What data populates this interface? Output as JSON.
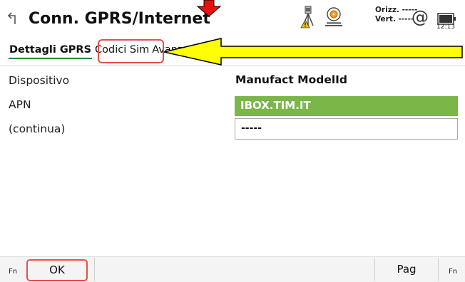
{
  "header": {
    "title": "Conn. GPRS/Internet",
    "precision": {
      "horiz_label": "Orizz.",
      "horiz_value": "-----",
      "vert_label": "Vert.",
      "vert_value": "-----"
    },
    "at_symbol": "@",
    "time": "12:13",
    "icons": [
      "back-icon",
      "total-station-warning-icon",
      "gnss-receiver-icon",
      "internet-at-icon",
      "battery-icon"
    ]
  },
  "tabs": [
    {
      "label": "Dettagli GPRS",
      "active": true
    },
    {
      "label": "Codici Sim",
      "active": false
    },
    {
      "label": "Avanzate",
      "active": false
    }
  ],
  "form": {
    "device_label": "Dispositivo",
    "device_value": "Manufact ModelId",
    "apn_label": "APN",
    "apn_value": "IBOX.TIM.IT",
    "continue_label": "(continua)",
    "continue_value": "-----"
  },
  "footer": {
    "fn_left": "Fn",
    "ok_label": "OK",
    "pag_label": "Pag",
    "fn_right": "Fn"
  },
  "colors": {
    "accent_green": "#7ab648",
    "tab_underline": "#1e8f3a",
    "annotation_red": "#e8504a",
    "annotation_arrow_yellow": "#ffff00",
    "annotation_arrow_red": "#e8100c"
  }
}
